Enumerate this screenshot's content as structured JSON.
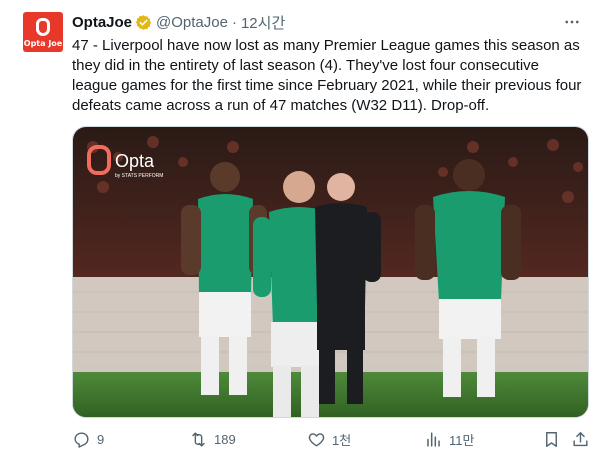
{
  "author": {
    "name": "OptaJoe",
    "handle": "@OptaJoe",
    "time": "12시간",
    "avatar_text": "Opta Joe"
  },
  "tweet": {
    "text": "47 - Liverpool have now lost as many Premier League games this season as they did in the entirety of last season (4). They've lost four consecutive league games for the first time since February 2021, while their previous four defeats came across a run of 47 matches (W32 D11). Drop-off."
  },
  "media": {
    "watermark_brand": "Opta",
    "watermark_sub": "by STATS PERFORM",
    "colors": {
      "kit": "#1a9c6e",
      "referee": "#1c1d21",
      "pitch": "#3f7a2e"
    }
  },
  "actions": {
    "reply_count": "9",
    "retweet_count": "189",
    "like_count": "1천",
    "views_count": "11만"
  },
  "icons": [
    "verified-badge-icon",
    "more-icon",
    "reply-icon",
    "retweet-icon",
    "like-icon",
    "views-icon",
    "bookmark-icon",
    "share-icon"
  ]
}
